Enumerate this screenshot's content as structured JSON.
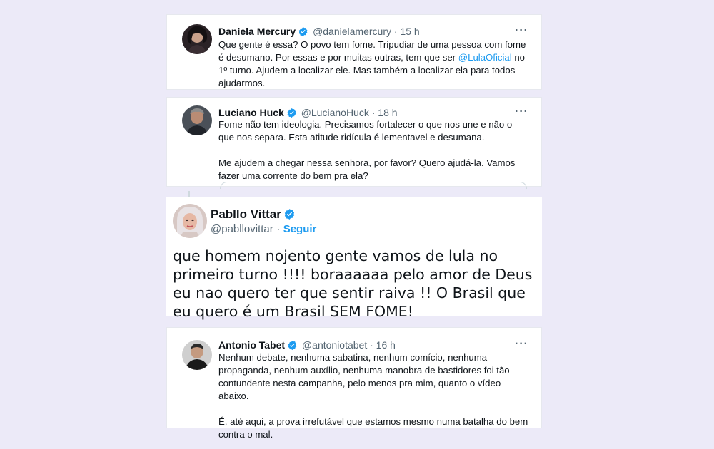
{
  "colors": {
    "background": "#eceaf8",
    "link": "#1d9bf0",
    "verified": "#1d9bf0",
    "secondary_text": "#536471"
  },
  "tweets": [
    {
      "name": "Daniela Mercury",
      "handle": "@danielamercury",
      "time": "· 15 h",
      "more_icon": "ellipsis-icon",
      "body_before_link": "Que gente é essa? O povo tem fome. Tripudiar de uma pessoa com fome é desumano. Por essas e por muitas outras, tem que ser ",
      "mention": "@LulaOficial",
      "body_after_link": " no 1º turno. Ajudem a localizar ele. Mas também a localizar ela para todos ajudarmos."
    },
    {
      "name": "Luciano Huck",
      "handle": "@LucianoHuck",
      "time": "· 18 h",
      "more_icon": "ellipsis-icon",
      "paragraph1": "Fome não tem ideologia. Precisamos fortalecer o que nos une e não o que nos separa. Esta atitude ridícula é lementavel e desumana.",
      "paragraph2": "Me ajudem a chegar nessa senhora, por favor? Quero ajudá-la. Vamos fazer uma corrente do bem pra ela?"
    },
    {
      "name": "Pabllo Vittar",
      "handle": "@pabllovittar",
      "separator": "·",
      "follow_label": "Seguir",
      "body": "que homem nojento gente vamos de lula no primeiro turno !!!! boraaaaaa pelo amor de Deus eu nao quero ter que sentir raiva !! O Brasil que eu quero é um Brasil SEM FOME!"
    },
    {
      "name": "Antonio Tabet",
      "handle": "@antoniotabet",
      "time": "· 16 h",
      "more_icon": "ellipsis-icon",
      "paragraph1": "Nenhum debate, nenhuma sabatina, nenhum comício, nenhuma propaganda, nenhum auxílio, nenhuma manobra de bastidores foi tão contundente nesta campanha, pelo menos pra mim, quanto o vídeo abaixo.",
      "paragraph2": "É, até aqui, a prova irrefutável que estamos mesmo numa batalha do bem contra o mal."
    }
  ]
}
